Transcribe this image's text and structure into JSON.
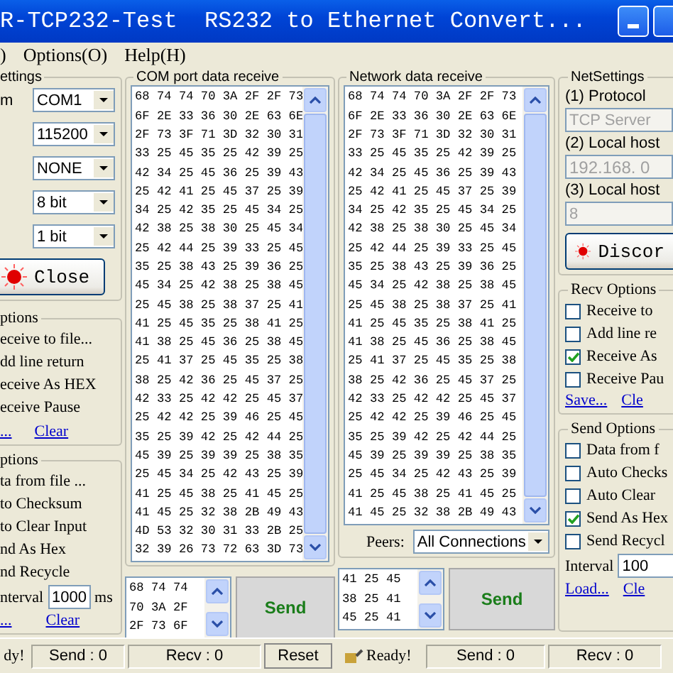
{
  "window": {
    "title": "R-TCP232-Test  RS232 to Ethernet Convert...",
    "buttons": [
      {
        "kind": "minimize"
      },
      {
        "kind": "maximize"
      }
    ]
  },
  "menu": [
    ")",
    "Options(O)",
    "Help(H)"
  ],
  "com_settings": {
    "title": "ettings",
    "port_label": "m",
    "selects": [
      "COM1",
      "115200",
      "NONE",
      "8 bit",
      "1 bit"
    ],
    "button": "Close"
  },
  "com_recv_options": {
    "title": "ptions",
    "items": [
      "eceive to file...",
      "dd line return",
      "eceive As HEX",
      "eceive Pause"
    ],
    "links": [
      "...",
      "Clear"
    ]
  },
  "com_send_options": {
    "title": "ptions",
    "items": [
      "ta from file ...",
      "to Checksum",
      "to Clear Input",
      "nd As Hex",
      "nd Recycle"
    ],
    "interval_label": "nterval",
    "interval": "1000",
    "interval_unit": "ms",
    "links": [
      "...",
      "Clear"
    ]
  },
  "com_receive": {
    "title": "COM port data receive",
    "rows": [
      "68 74 74 70 3A 2F 2F 73",
      "6F 2E 33 36 30 2E 63 6E",
      "2F 73 3F 71 3D 32 30 31",
      "33 25 45 35 25 42 39 25",
      "42 34 25 45 36 25 39 43",
      "25 42 41 25 45 37 25 39",
      "34 25 42 35 25 45 34 25",
      "42 38 25 38 30 25 45 34",
      "25 42 44 25 39 33 25 45",
      "35 25 38 43 25 39 36 25",
      "45 34 25 42 38 25 38 45",
      "25 45 38 25 38 37 25 41",
      "41 25 45 35 25 38 41 25",
      "41 38 25 45 36 25 38 45",
      "25 41 37 25 45 35 25 38",
      "38 25 42 36 25 45 37 25",
      "42 33 25 42 42 25 45 37",
      "25 42 42 25 39 46 25 45",
      "35 25 39 42 25 42 44 25",
      "45 39 25 39 39 25 38 35",
      "25 45 34 25 42 43 25 39",
      "41 25 45 38 25 41 45 25",
      "41 45 25 32 38 2B 49 43",
      "4D 53 32 30 31 33 2B 25",
      "32 39 26 73 72 63 3D 73"
    ]
  },
  "com_send": {
    "lines": [
      "68 74 74",
      "70 3A 2F",
      "2F 73 6F"
    ],
    "button": "Send"
  },
  "network_receive": {
    "title": "Network data receive",
    "rows": [
      "68 74 74 70 3A 2F 2F 73",
      "6F 2E 33 36 30 2E 63 6E",
      "2F 73 3F 71 3D 32 30 31",
      "33 25 45 35 25 42 39 25",
      "42 34 25 45 36 25 39 43",
      "25 42 41 25 45 37 25 39",
      "34 25 42 35 25 45 34 25",
      "42 38 25 38 30 25 45 34",
      "25 42 44 25 39 33 25 45",
      "35 25 38 43 25 39 36 25",
      "45 34 25 42 38 25 38 45",
      "25 45 38 25 38 37 25 41",
      "41 25 45 35 25 38 41 25",
      "41 38 25 45 36 25 38 45",
      "25 41 37 25 45 35 25 38",
      "38 25 42 36 25 45 37 25",
      "42 33 25 42 42 25 45 37",
      "25 42 42 25 39 46 25 45",
      "35 25 39 42 25 42 44 25",
      "45 39 25 39 39 25 38 35",
      "25 45 34 25 42 43 25 39",
      "41 25 45 38 25 41 45 25",
      "41 45 25 32 38 2B 49 43"
    ]
  },
  "peers": {
    "label": "Peers:",
    "value": "All Connections"
  },
  "network_send": {
    "lines": [
      "41 25 45",
      "38 25 41",
      "45 25 41"
    ],
    "button": "Send"
  },
  "net_settings": {
    "title": "NetSettings",
    "protocol_label": "(1) Protocol",
    "protocol": "TCP Server",
    "host_label": "(2) Local host",
    "host": "192.168. 0",
    "port_label": "(3) Local host",
    "port": "8",
    "button": "Discor"
  },
  "net_recv_options": {
    "title": "Recv Options",
    "items": [
      {
        "label": "Receive to",
        "checked": false
      },
      {
        "label": "Add line re",
        "checked": false
      },
      {
        "label": "Receive As",
        "checked": true
      },
      {
        "label": "Receive Pau",
        "checked": false
      }
    ],
    "links": [
      "Save...",
      "Cle"
    ]
  },
  "net_send_options": {
    "title": "Send Options",
    "items": [
      {
        "label": "Data from f",
        "checked": false
      },
      {
        "label": "Auto Checks",
        "checked": false
      },
      {
        "label": "Auto Clear",
        "checked": false
      },
      {
        "label": "Send As Hex",
        "checked": true
      },
      {
        "label": "Send Recycl",
        "checked": false
      }
    ],
    "interval_label": "Interval",
    "interval": "100",
    "links": [
      "Load...",
      "Cle"
    ]
  },
  "status_bar": [
    {
      "kind": "text",
      "text": "dy!"
    },
    {
      "kind": "counter",
      "text": "Send : 0"
    },
    {
      "kind": "counter",
      "text": "Recv : 0"
    },
    {
      "kind": "button",
      "text": "Reset"
    },
    {
      "kind": "status",
      "text": "Ready!"
    },
    {
      "kind": "counter",
      "text": "Send : 0"
    },
    {
      "kind": "counter",
      "text": "Recv : 0"
    }
  ]
}
